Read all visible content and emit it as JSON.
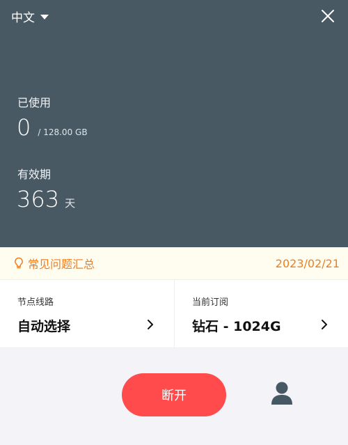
{
  "header": {
    "language": "中文",
    "used_label": "已使用",
    "used_value": "0",
    "used_total": "/ 128.00 GB",
    "validity_label": "有效期",
    "validity_value": "363",
    "validity_unit": "天"
  },
  "faq": {
    "label": "常见问题汇总",
    "date": "2023/02/21"
  },
  "cards": {
    "route_title": "节点线路",
    "route_value": "自动选择",
    "subscription_title": "当前订阅",
    "subscription_value": "钻石 - 1024G"
  },
  "actions": {
    "disconnect_label": "断开"
  },
  "colors": {
    "header_bg": "#485963",
    "accent_orange": "#ee7d22",
    "disconnect_red": "#ff4b4b"
  },
  "icons": [
    "chevron-down-icon",
    "close-icon",
    "lightbulb-icon",
    "chevron-right-icon",
    "user-icon"
  ]
}
